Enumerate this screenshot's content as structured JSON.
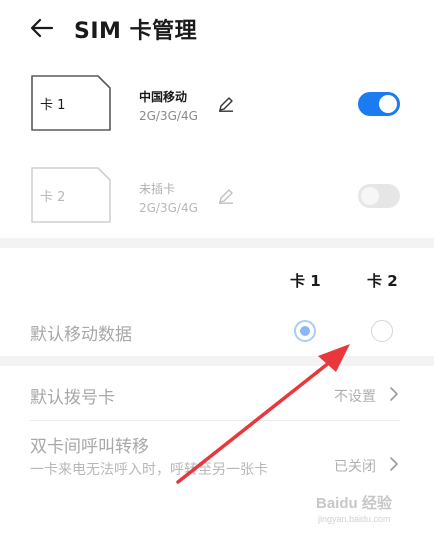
{
  "header": {
    "title": "SIM 卡管理",
    "back_icon": "arrow-left-icon"
  },
  "sims": [
    {
      "slot_label": "卡 1",
      "carrier": "中国移动",
      "network": "2G/3G/4G",
      "enabled": true
    },
    {
      "slot_label": "卡 2",
      "carrier": "未插卡",
      "network": "2G/3G/4G",
      "enabled": false
    }
  ],
  "default_data": {
    "label": "默认移动数据",
    "columns": [
      "卡 1",
      "卡 2"
    ],
    "selected_index": 0
  },
  "default_dial": {
    "label": "默认拨号卡",
    "value": "不设置"
  },
  "call_forward": {
    "label": "双卡间呼叫转移",
    "description": "一卡来电无法呼入时，呼转至另一张卡",
    "value": "已关闭"
  },
  "colors": {
    "accent": "#1b7cf2",
    "annotation_arrow": "#e8383d"
  },
  "watermark": {
    "brand": "Baidu 经验",
    "site": "jingyan.baidu.com"
  }
}
